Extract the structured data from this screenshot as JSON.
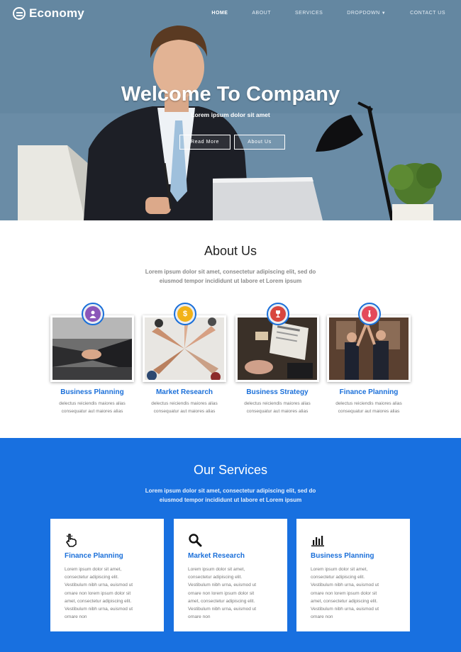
{
  "brand": {
    "name": "Economy"
  },
  "nav": {
    "items": [
      {
        "label": "HOME",
        "active": true
      },
      {
        "label": "ABOUT"
      },
      {
        "label": "SERVICES"
      },
      {
        "label": "DROPDOWN"
      },
      {
        "label": "CONTACT US"
      }
    ]
  },
  "hero": {
    "title": "Welcome To Company",
    "subtitle": "Lorem ipsum dolor sit amet",
    "buttons": {
      "read_more": "Read More",
      "about_us": "About Us"
    }
  },
  "about": {
    "title": "About Us",
    "lead_line1": "Lorem ipsum dolor sit amet, consectetur adipiscing elit, sed do",
    "lead_line2": "eiusmod tempor incididunt ut labore et Lorem ipsum",
    "cards": [
      {
        "title": "Business Planning",
        "icon": "person-icon",
        "text_line1": "delectus reiciendis maiores alias",
        "text_line2": "consequatur aut maiores alias"
      },
      {
        "title": "Market Research",
        "icon": "dollar-icon",
        "text_line1": "delectus reiciendis maiores alias",
        "text_line2": "consequatur aut maiores alias"
      },
      {
        "title": "Business Strategy",
        "icon": "trophy-icon",
        "text_line1": "delectus reiciendis maiores alias",
        "text_line2": "consequatur aut maiores alias"
      },
      {
        "title": "Finance Planning",
        "icon": "tie-icon",
        "text_line1": "delectus reiciendis maiores alias",
        "text_line2": "consequatur aut maiores alias"
      }
    ]
  },
  "services": {
    "title": "Our Services",
    "lead_line1": "Lorem ipsum dolor sit amet, consectetur adipiscing elit, sed do",
    "lead_line2": "eiusmod tempor incididunt ut labore et Lorem ipsum",
    "cards": [
      {
        "title": "Finance Planning",
        "icon": "hand-pointer-icon",
        "lines": [
          "Lorem ipsum dolor sit amet,",
          "consectetur adipiscing elit.",
          "Vestibulum nibh urna, euismod ut",
          "ornare non lorem ipsum dolor sit",
          "amet, consectetur adipiscing elit.",
          "Vestibulum nibh urna, euismod ut",
          "ornare non"
        ]
      },
      {
        "title": "Market Research",
        "icon": "search-icon",
        "lines": [
          "Lorem ipsum dolor sit amet,",
          "consectetur adipiscing elit.",
          "Vestibulum nibh urna, euismod ut",
          "ornare non lorem ipsum dolor sit",
          "amet, consectetur adipiscing elit.",
          "Vestibulum nibh urna, euismod ut",
          "ornare non"
        ]
      },
      {
        "title": "Business Planning",
        "icon": "bar-chart-icon",
        "lines": [
          "Lorem ipsum dolor sit amet,",
          "consectetur adipiscing elit.",
          "Vestibulum nibh urna, euismod ut",
          "ornare non lorem ipsum dolor sit",
          "amet, consectetur adipiscing elit.",
          "Vestibulum nibh urna, euismod ut",
          "ornare non"
        ]
      }
    ]
  },
  "colors": {
    "accent": "#1a6fd9",
    "services_bg": "#1870e0"
  }
}
